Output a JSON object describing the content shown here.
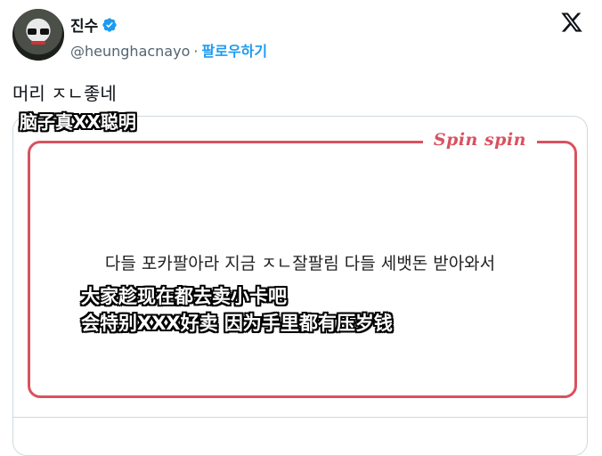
{
  "user": {
    "display_name": "진수",
    "handle": "@heunghacnayo",
    "separator": "·",
    "follow_label": "팔로우하기"
  },
  "tweet": {
    "text": "머리 ㅈㄴ좋네"
  },
  "subtitles": {
    "top": "脑子真XX聪明",
    "line1": "大家趁现在都去卖小卡吧",
    "line2": "会特别XXX好卖 因为手里都有压岁钱"
  },
  "media": {
    "brand": "Spin spin",
    "notice": "다들 포카팔아라 지금 ㅈㄴ잘팔림 다들 세뱃돈 받아와서"
  },
  "colors": {
    "accent": "#1d9bf0",
    "frame": "#d8525f",
    "text": "#0f1419",
    "muted": "#536471"
  },
  "icons": {
    "verified": "verified-badge-icon",
    "x": "x-logo-icon"
  }
}
